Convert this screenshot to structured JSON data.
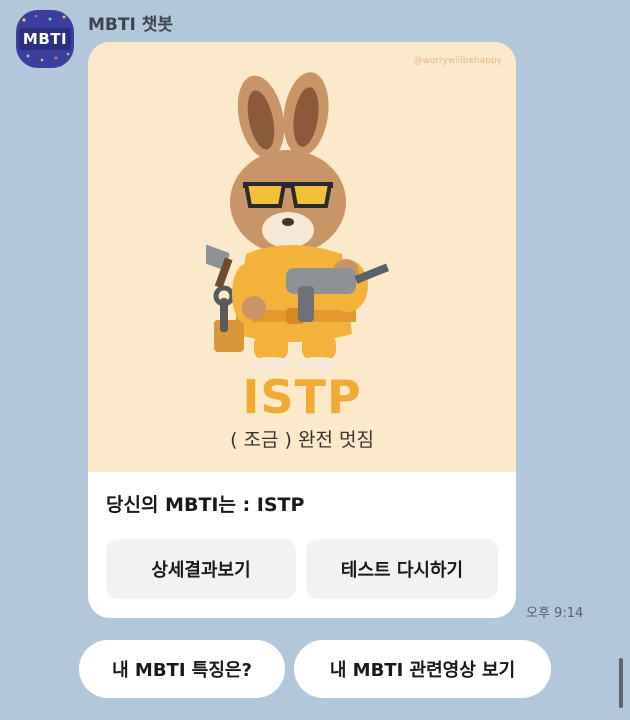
{
  "chat": {
    "sender_name": "MBTI 챗봇",
    "avatar_text": "MBTI",
    "timestamp": "오후 9:14"
  },
  "card": {
    "watermark": "@worrywillbehappy",
    "mbti_type": "ISTP",
    "subtitle": "( 조금 ) 완전 멋짐",
    "result_text": "당신의 MBTI는 : ISTP",
    "buttons": {
      "detail_label": "상세결과보기",
      "retry_label": "테스트 다시하기"
    }
  },
  "quick_replies": [
    {
      "label": "내 MBTI 특징은?"
    },
    {
      "label": "내 MBTI 관련영상 보기"
    }
  ],
  "colors": {
    "background": "#b2c7d9",
    "card_image_bg": "#fbe9c9",
    "accent_type": "#f0ab36",
    "avatar": "#3a3f9e"
  },
  "icons": [
    "mbti-avatar-icon",
    "rabbit-illustration"
  ]
}
